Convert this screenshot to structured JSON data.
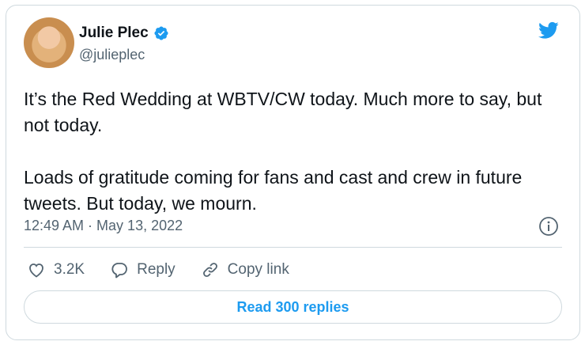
{
  "author": {
    "display_name": "Julie Plec",
    "handle": "@julieplec",
    "verified": true
  },
  "tweet": {
    "text": "It’s the Red Wedding at WBTV/CW today. Much more to say, but not today.\n\nLoads of gratitude coming for fans and cast and crew in future tweets. But today, we mourn.",
    "timestamp": "12:49 AM · May 13, 2022"
  },
  "actions": {
    "like_count": "3.2K",
    "reply_label": "Reply",
    "copy_label": "Copy link"
  },
  "read_replies_label": "Read 300 replies",
  "colors": {
    "accent": "#1d9bf0",
    "muted": "#536471",
    "border": "#cfd9de"
  },
  "icons": [
    "verified-badge-icon",
    "twitter-bird-icon",
    "info-icon",
    "heart-icon",
    "reply-bubble-icon",
    "link-icon"
  ]
}
